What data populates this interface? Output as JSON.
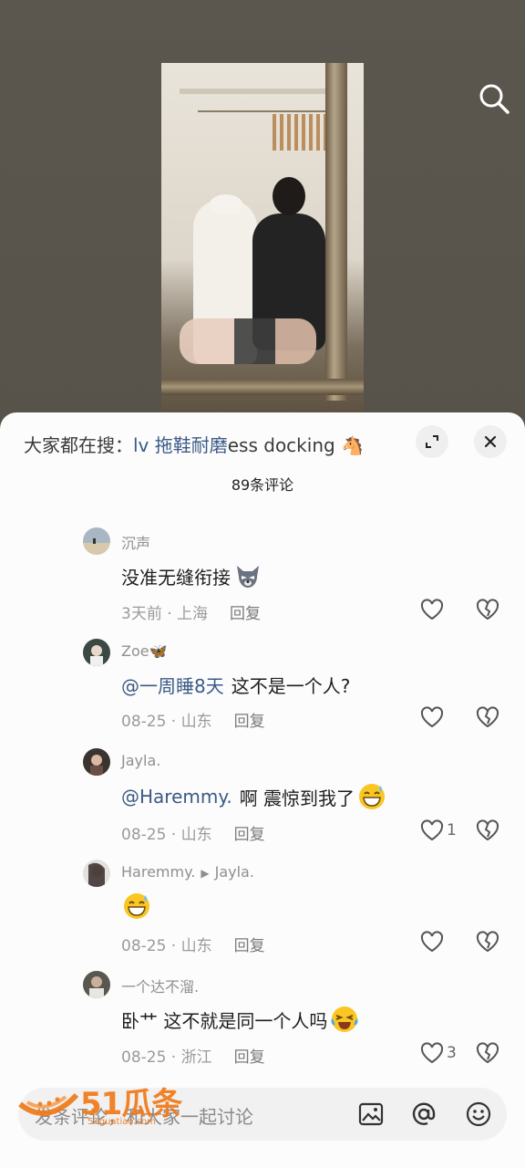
{
  "hot_search": {
    "prefix": "大家都在搜：",
    "term": "lv 拖鞋耐磨",
    "rest": "ess docking 🐴"
  },
  "comment_count": "89条评论",
  "comments": [
    {
      "user": "沉声",
      "text": "没准无缝衔接",
      "mention": "",
      "emoji": "wolf-emoji",
      "time": "3天前",
      "location": "上海",
      "reply_label": "回复",
      "likes": ""
    },
    {
      "user": "Zoe🦋",
      "mention": "@一周睡8天",
      "text": "这不是一个人?",
      "emoji": "",
      "time": "08-25",
      "location": "山东",
      "reply_label": "回复",
      "likes": ""
    },
    {
      "user": "Jayla.",
      "mention": "@Haremmy.",
      "text": "啊 震惊到我了",
      "emoji": "grin-sweat-emoji",
      "time": "08-25",
      "location": "山东",
      "reply_label": "回复",
      "likes": "1"
    },
    {
      "user": "Haremmy.",
      "reply_to": "Jayla.",
      "mention": "",
      "text": "",
      "emoji": "grin-sweat-emoji",
      "time": "08-25",
      "location": "山东",
      "reply_label": "回复",
      "likes": ""
    },
    {
      "user": "一个达不溜.",
      "mention": "",
      "text": "卧艹 这不就是同一个人吗",
      "emoji": "crying-laugh-emoji",
      "time": "08-25",
      "location": "浙江",
      "reply_label": "回复",
      "likes": "3"
    }
  ],
  "input": {
    "placeholder": "发条评论，和大家一起讨论"
  },
  "watermark": {
    "text": "51瓜条",
    "sub": "51guatiao.com"
  },
  "colors": {
    "mention": "#3b5a86",
    "watermark": "#f07a1a",
    "sheet": "#fcfcfc"
  }
}
